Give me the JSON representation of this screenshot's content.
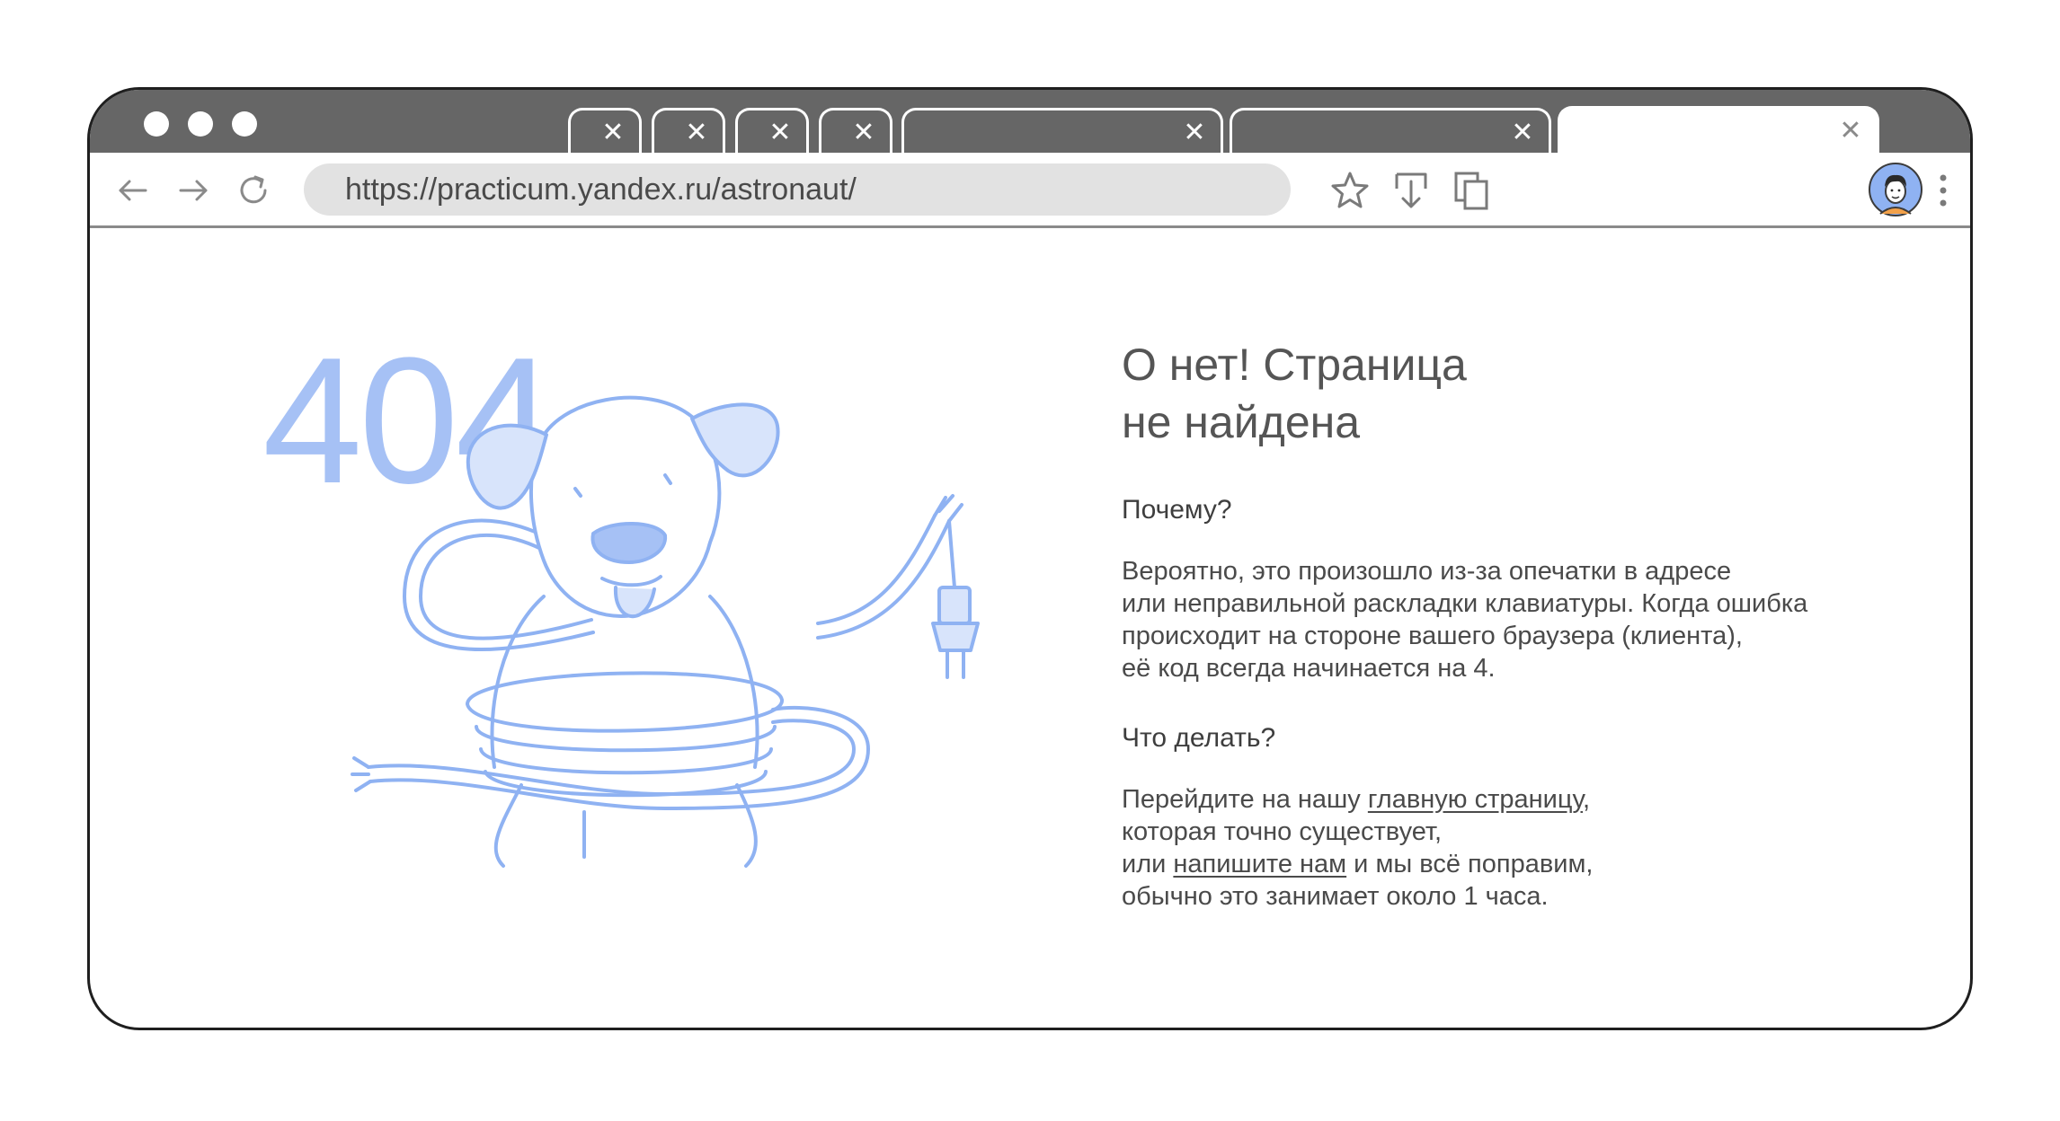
{
  "browser": {
    "url": "https://practicum.yandex.ru/astronaut/",
    "tab_close_glyph": "✕",
    "window_controls": [
      "dot",
      "dot",
      "dot"
    ],
    "icons": [
      "back-arrow-icon",
      "forward-arrow-icon",
      "reload-icon",
      "star-icon",
      "download-icon",
      "copy-icon",
      "avatar",
      "more-menu-icon"
    ]
  },
  "page": {
    "error_code": "404",
    "title_line1": "О нет! Страница",
    "title_line2": "не найдена",
    "why_heading": "Почему?",
    "why_lines": [
      "Вероятно, это произошло из-за опечатки в адресе",
      "или неправильной раскладки клавиатуры. Когда ошибка",
      "происходит на стороне вашего браузера (клиента),",
      "её код всегда начинается на 4."
    ],
    "what_heading": "Что делать?",
    "what_line1_prefix": "Перейдите на нашу ",
    "what_line1_link": "главную страницу",
    "what_line1_suffix": ",",
    "what_line2": "которая точно существует,",
    "what_line3_prefix": "или ",
    "what_line3_link": "напишите нам",
    "what_line3_suffix": " и мы всё поправим,",
    "what_line4": "обычно это занимает около 1 часа."
  },
  "colors": {
    "titlebar": "#666666",
    "accent_blue": "#a6c1f5",
    "url_bg": "#e2e2e2"
  }
}
